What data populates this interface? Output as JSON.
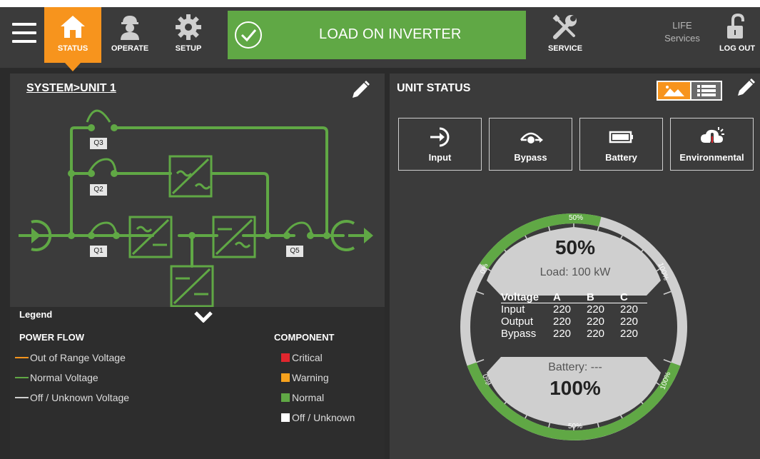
{
  "nav": {
    "status_label": "STATUS",
    "operate_label": "OPERATE",
    "setup_label": "SETUP",
    "service_label": "SERVICE",
    "life_line1": "LIFE",
    "life_line2": "Services",
    "logout_label": "LOG OUT"
  },
  "banner": {
    "message": "LOAD ON INVERTER"
  },
  "left": {
    "breadcrumb_system": "SYSTEM",
    "breadcrumb_sep": ">",
    "breadcrumb_unit": "UNIT 1",
    "breakers": [
      "Q3",
      "Q2",
      "Q1",
      "Q5"
    ]
  },
  "legend": {
    "title": "Legend",
    "power_flow_title": "POWER FLOW",
    "power_flow": [
      {
        "label": "Out of Range Voltage",
        "color": "#f7941d"
      },
      {
        "label": "Normal Voltage",
        "color": "#60a845"
      },
      {
        "label": "Off / Unknown Voltage",
        "color": "#cfcfcf"
      }
    ],
    "component_title": "COMPONENT",
    "component": [
      {
        "label": "Critical",
        "color": "#e0262e"
      },
      {
        "label": "Warning",
        "color": "#f7a21d"
      },
      {
        "label": "Normal",
        "color": "#60a845"
      },
      {
        "label": "Off / Unknown",
        "color": "#ffffff"
      }
    ]
  },
  "right": {
    "title": "UNIT STATUS",
    "tiles": [
      "Input",
      "Bypass",
      "Battery",
      "Environmental"
    ]
  },
  "gauge": {
    "load_percent_text": "50%",
    "load_label": "Load: 100 kW",
    "battery_label": "Battery: ---",
    "battery_percent_text": "100%",
    "load_level": 0.5,
    "battery_level": 1.0,
    "top_ticks": [
      "0%",
      "50%",
      "100%"
    ],
    "bottom_ticks": [
      "0%",
      "50%",
      "100%"
    ]
  },
  "voltage_table": {
    "headers": [
      "Voltage",
      "A",
      "B",
      "C"
    ],
    "rows": [
      {
        "name": "Input",
        "a": "220",
        "b": "220",
        "c": "220"
      },
      {
        "name": "Output",
        "a": "220",
        "b": "220",
        "c": "220"
      },
      {
        "name": "Bypass",
        "a": "220",
        "b": "220",
        "c": "220"
      }
    ]
  },
  "colors": {
    "accent_orange": "#f7941d",
    "normal_green": "#60a845",
    "panel_bg": "#3b3b3b"
  }
}
